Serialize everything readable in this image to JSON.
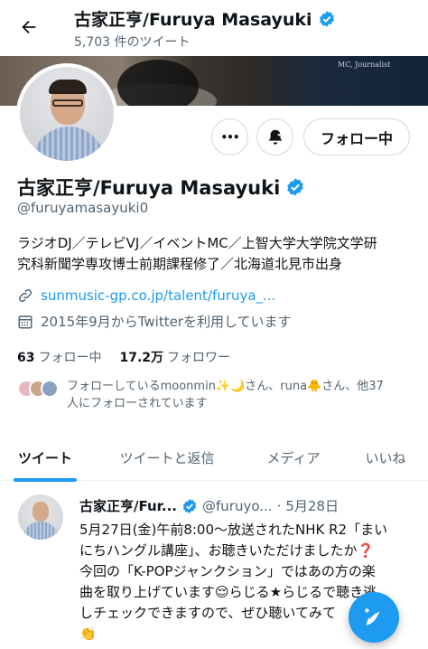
{
  "header": {
    "title": "古家正亨/Furuya Masayuki",
    "tweet_count": "5,703 件のツイート"
  },
  "banner": {
    "caption": "MC, Journalist"
  },
  "profile": {
    "name": "古家正亨/Furuya Masayuki",
    "handle": "@furuyamasayuki0",
    "bio_line1": "ラジオDJ／テレビVJ／イベントMC／上智大学大学院文学研",
    "bio_line2": "究科新聞学専攻博士前期課程修了／北海道北見市出身",
    "link": "sunmusic-gp.co.jp/talent/furuya_...",
    "joined": "2015年9月からTwitterを利用しています",
    "following_count": "63",
    "following_label": "フォロー中",
    "followers_count": "17.2万",
    "followers_label": "フォロワー",
    "known_line1": "フォローしているmoonmin✨🌙さん、runa🐥さん、他37",
    "known_line2": "人にフォローされています"
  },
  "actions": {
    "more_label": "•••",
    "follow_label": "フォロー中"
  },
  "tabs": [
    {
      "label": "ツイート",
      "active": true
    },
    {
      "label": "ツイートと返信",
      "active": false
    },
    {
      "label": "メディア",
      "active": false
    },
    {
      "label": "いいね",
      "active": false
    }
  ],
  "tweet": {
    "name": "古家正亨/Fur...",
    "handle": "@furuyo...",
    "sep": "·",
    "date": "5月28日",
    "line1": "5月27日(金)午前8:00〜放送されたNHK R2「まい",
    "line2": "にちハングル講座」、お聴きいただけましたか❓",
    "line3": "今回の「K-POPジャンクション」ではあの方の楽",
    "line4": "曲を取り上げています😌らじる★らじるで聴き逃",
    "line5": "しチェックできますので、ぜひ聴いてみて",
    "line6": "👏"
  },
  "colors": {
    "accent": "#1d9bf0",
    "text": "#0f1419",
    "muted": "#536471",
    "border": "#cfd9de"
  },
  "icons": [
    "back-arrow-icon",
    "verified-badge-icon",
    "more-icon",
    "bell-notification-icon",
    "link-icon",
    "calendar-icon",
    "compose-tweet-icon"
  ]
}
